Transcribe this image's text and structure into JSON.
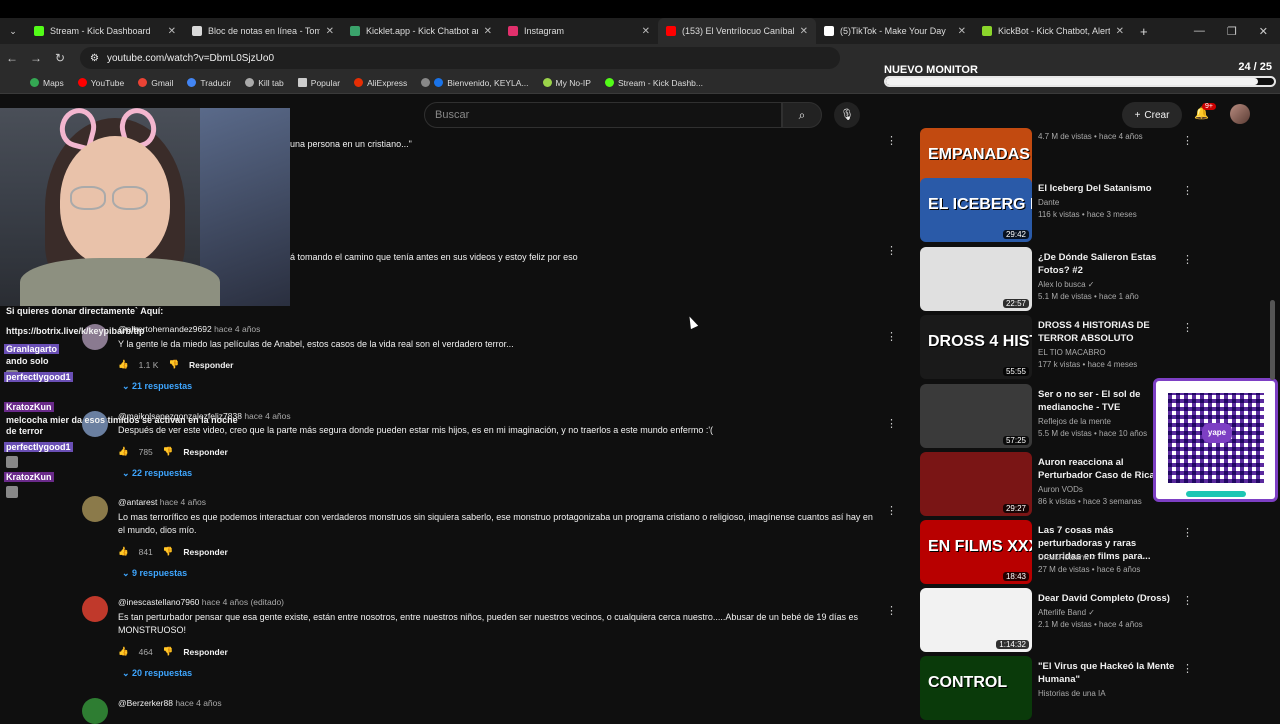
{
  "browser": {
    "tabs": [
      {
        "label": "Stream - Kick Dashboard",
        "color": "#53fc18"
      },
      {
        "label": "Bloc de notas en línea - Toma y",
        "color": "#d9d9d9"
      },
      {
        "label": "Kicklet.app - Kick Chatbot and",
        "color": "#3aa36b"
      },
      {
        "label": "Instagram",
        "color": "#e1306c"
      },
      {
        "label": "(153) El Ventrílocuo Caníbal [RE",
        "color": "#ff0000"
      },
      {
        "label": "(5)TikTok - Make Your Day",
        "color": "#ffffff"
      },
      {
        "label": "KickBot - Kick Chatbot, Alerts,",
        "color": "#8bd52b"
      }
    ],
    "url": "youtube.com/watch?v=DbmL0SjzUo0",
    "bookmarks": [
      "Maps",
      "YouTube",
      "Gmail",
      "Traducir",
      "Kill tab",
      "Popular",
      "AliExpress",
      "Bienvenido, KEYLA...",
      "My No-IP",
      "Stream - Kick Dashb..."
    ]
  },
  "monitor": {
    "label": "NUEVO MONITOR",
    "count": "24 / 25",
    "progress": 0.96
  },
  "youtube": {
    "search_placeholder": "Buscar",
    "create_label": "Crear",
    "notif_badge": "9+"
  },
  "comments": {
    "partial1": "una persona en un cristiano...\"",
    "partial2": "á tomando el camino que tenía antes en sus videos y estoy feliz por eso",
    "items": [
      {
        "handle": "@albertohernandez9692",
        "time": "hace 4 años",
        "text": "Y la gente le da miedo las películas de Anabel, estos casos de la vida real son el verdadero terror...",
        "likes": "1.1 K",
        "replies": "21 respuestas"
      },
      {
        "handle": "@maikolsanezgonzalezfeliz7838",
        "time": "hace 4 años",
        "text": "Después de ver este video, creo que la parte más segura donde pueden estar mis hijos, es en mi imaginación, y no traerlos a este mundo enfermo  :'(",
        "likes": "785",
        "replies": "22 respuestas"
      },
      {
        "handle": "@antarest",
        "time": "hace 4 años",
        "text": "Lo mas terrorífico es que podemos interactuar con verdaderos monstruos sin siquiera saberlo, ese monstruo protagonizaba un programa cristiano o religioso, imagínense cuantos así hay en el mundo, dios mío.",
        "likes": "841",
        "replies": "9 respuestas"
      },
      {
        "handle": "@inescastellano7960",
        "time": "hace 4 años (editado)",
        "text": "Es tan perturbador pensar que esa gente existe, están entre nosotros, entre nuestros niños, pueden ser nuestros vecinos, o cualquiera cerca nuestro.....Abusar de un bebé de 19 días es MONSTRUOSO!",
        "likes": "464",
        "replies": "20 respuestas"
      },
      {
        "handle": "@Berzerker88",
        "time": "hace 4 años"
      }
    ],
    "reply_label": "Responder"
  },
  "chat": [
    {
      "text": "Si quieres donar directamente`  Aquí:"
    },
    {
      "text": "https://botrix.live/k/keypibarb/tip"
    },
    {
      "name": "Granlagarto",
      "text": ""
    },
    {
      "text": "ando solo"
    },
    {
      "name": "perfectlygood1",
      "text": ""
    },
    {
      "name": "KratozKun",
      "text": ""
    },
    {
      "text": "melcocha mier da esos timidos se activan en la noche"
    },
    {
      "text": "de terror"
    },
    {
      "name": "perfectlygood1",
      "text": ""
    },
    {
      "name": "KratozKun",
      "text": ""
    }
  ],
  "sidebar_videos": [
    {
      "title": "",
      "channel": "",
      "meta": "4.7 M de vistas • hace 4 años",
      "duration": "12:19",
      "thumb_text": "EMPANADAS",
      "thumb_color": "#c24a10"
    },
    {
      "title": "El Iceberg Del Satanismo",
      "channel": "Dante",
      "meta": "116 k vistas • hace 3 meses",
      "duration": "29:42",
      "thumb_text": "EL ICEBERG DEL",
      "thumb_color": "#2a5aa8"
    },
    {
      "title": "¿De Dónde Salieron Estas Fotos? #2",
      "channel": "Alex lo busca ✓",
      "meta": "5.1 M de vistas • hace 1 año",
      "duration": "22:57",
      "thumb_text": "",
      "thumb_color": "#e0e0e0"
    },
    {
      "title": "DROSS 4 HISTORIAS DE TERROR ABSOLUTO",
      "channel": "EL TIO MACABRO",
      "meta": "177 k vistas • hace 4 meses",
      "duration": "55:55",
      "thumb_text": "DROSS 4 HISTORIAS DE TERROR",
      "thumb_color": "#1a1a1a"
    },
    {
      "title": "Ser o no ser - El sol de medianoche - TVE",
      "channel": "Reflejos de la mente",
      "meta": "5.5 M de vistas • hace 10 años",
      "duration": "57:25",
      "thumb_text": "",
      "thumb_color": "#3a3a3a"
    },
    {
      "title": "Auron reacciona al Perturbador Caso de Ricardo",
      "channel": "Auron VODs",
      "meta": "86 k vistas • hace 3 semanas",
      "duration": "29:27",
      "thumb_text": "",
      "thumb_color": "#7a1515"
    },
    {
      "title": "Las 7 cosas más perturbadoras y raras ocurridas en films para...",
      "channel": "DrossRotzank ✓",
      "meta": "27 M de vistas • hace 6 años",
      "duration": "18:43",
      "thumb_text": "EN FILMS XXX",
      "thumb_color": "#b80000"
    },
    {
      "title": "Dear David Completo (Dross)",
      "channel": "Afterlife Band ✓",
      "meta": "2.1 M de vistas • hace 4 años",
      "duration": "1:14:32",
      "thumb_text": "",
      "thumb_color": "#f2f2f2"
    },
    {
      "title": "\"El Virus que Hackeó la Mente Humana\"",
      "channel": "Historias de una IA",
      "meta": "",
      "duration": "",
      "thumb_text": "CONTROL",
      "thumb_color": "#0a3a0a"
    }
  ]
}
